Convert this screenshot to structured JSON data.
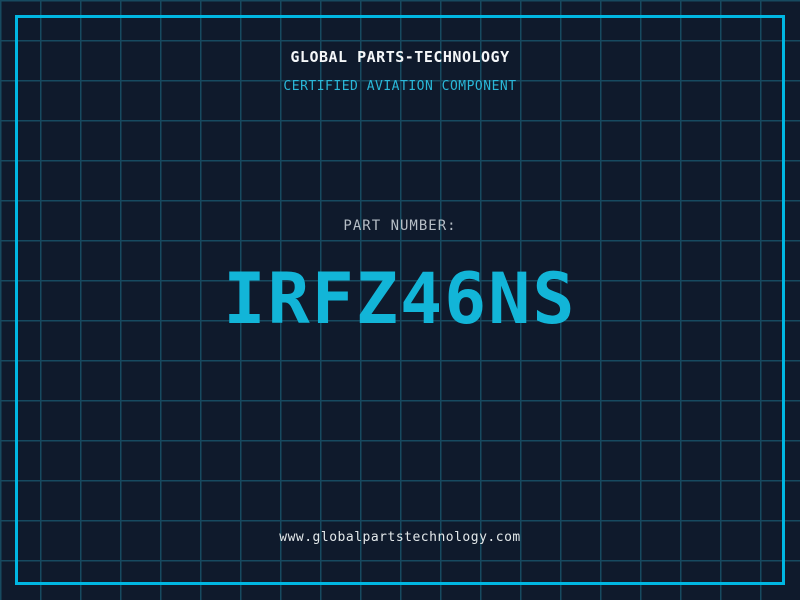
{
  "theme": {
    "background": "#0f1a2c",
    "grid_line_color": "#174a60",
    "frame_color": "#00b6e2",
    "accent_cyan": "#12b5d8",
    "subtitle_cyan": "#2ab7d8",
    "text_primary": "#f4f6f8",
    "text_muted": "#b6bec6",
    "grid_cell_size_px": 40
  },
  "header": {
    "company": "GLOBAL PARTS-TECHNOLOGY",
    "subtitle": "CERTIFIED AVIATION COMPONENT"
  },
  "part": {
    "label": "PART NUMBER:",
    "number": "IRFZ46NS"
  },
  "footer": {
    "website": "www.globalpartstechnology.com"
  }
}
